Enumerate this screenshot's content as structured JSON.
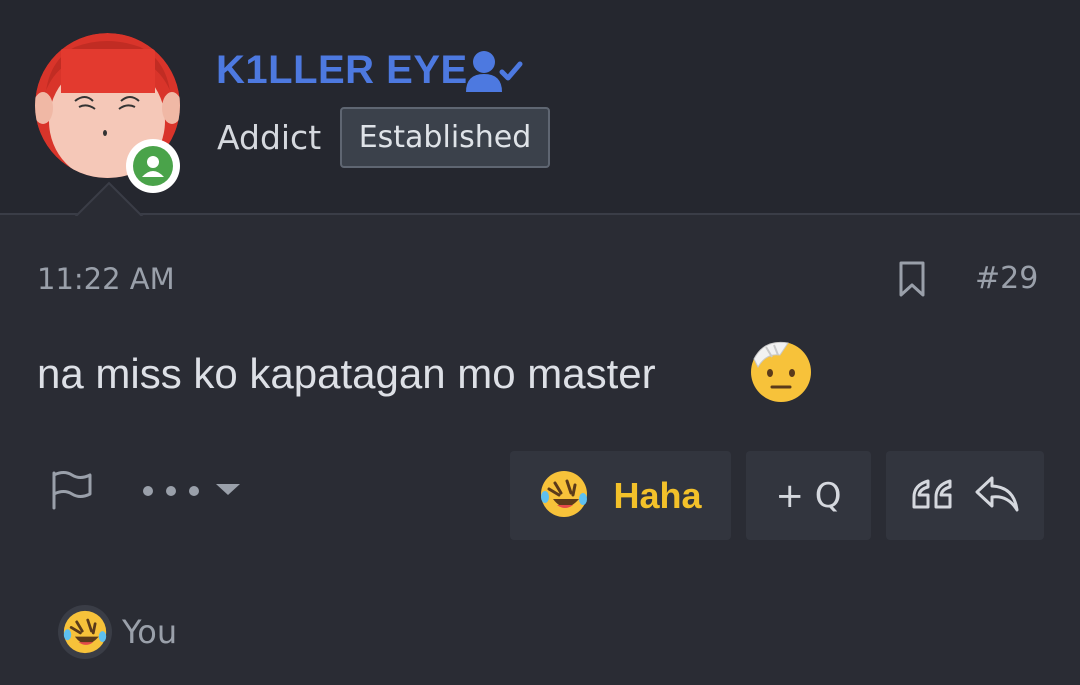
{
  "user": {
    "name": "K1LLER EYE",
    "title": "Addict",
    "badge": "Established",
    "status": "online"
  },
  "post": {
    "time": "11:22 AM",
    "number": "#29",
    "message": "na miss ko kapatagan mo master",
    "message_emoji": "face-with-head-bandage-emoji"
  },
  "actions": {
    "reaction_label": "Haha",
    "multiquote_label": "+ Q",
    "more_icon": "ellipsis-caret-icon",
    "report_icon": "flag-icon",
    "bookmark_icon": "bookmark-icon",
    "quote_icon": "quote-icon",
    "reply_icon": "reply-icon"
  },
  "reactions_summary": {
    "reacted_by": "You",
    "reaction_icon": "rolling-laughing-emoji"
  },
  "colors": {
    "background": "#2a2c34",
    "header": "#25272f",
    "username": "#4d79e0",
    "reaction_text": "#f3c12a",
    "online": "#4aa34a"
  }
}
